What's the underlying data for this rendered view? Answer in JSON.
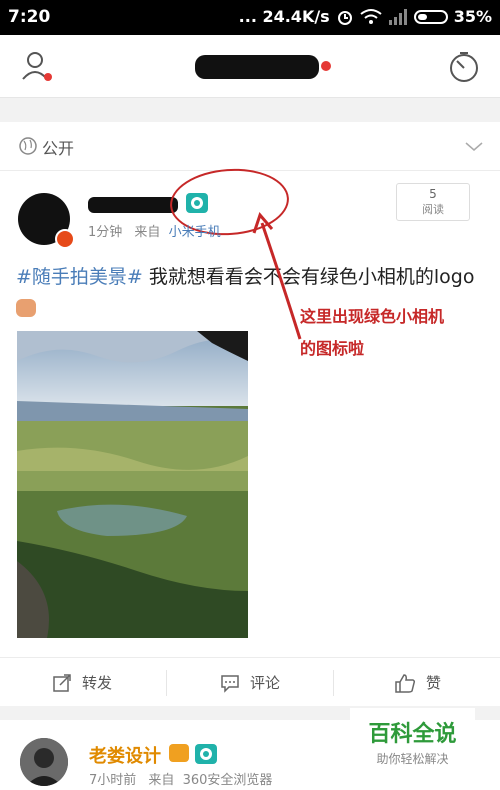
{
  "status_bar": {
    "time": "7:20",
    "network_speed": "... 24.4K/s",
    "battery": "35%"
  },
  "nav": {
    "icons": [
      "user-icon",
      "timer-icon"
    ]
  },
  "visibility": {
    "label": "公开"
  },
  "post": {
    "time": "1分钟",
    "source_prefix": "来自",
    "source": "小米手机",
    "read_count": "5",
    "read_label": "阅读",
    "hashtag": "#随手拍美景#",
    "text": " 我就想看看会不会有绿色小相机的logo"
  },
  "annotation": {
    "line1": "这里出现绿色小相机",
    "line2": "的图标啦",
    "color": "#c62828"
  },
  "actions": {
    "repost": "转发",
    "comment": "评论",
    "like": "赞"
  },
  "post2": {
    "username": "老娄设计",
    "time": "7小时前",
    "source_prefix": "来自",
    "source": "360安全浏览器"
  },
  "watermark": {
    "title": "百科全说",
    "subtitle": "助你轻松解决"
  },
  "colors": {
    "link": "#4a7db8",
    "camera_badge": "#20b2aa",
    "username2": "#e08a00"
  }
}
